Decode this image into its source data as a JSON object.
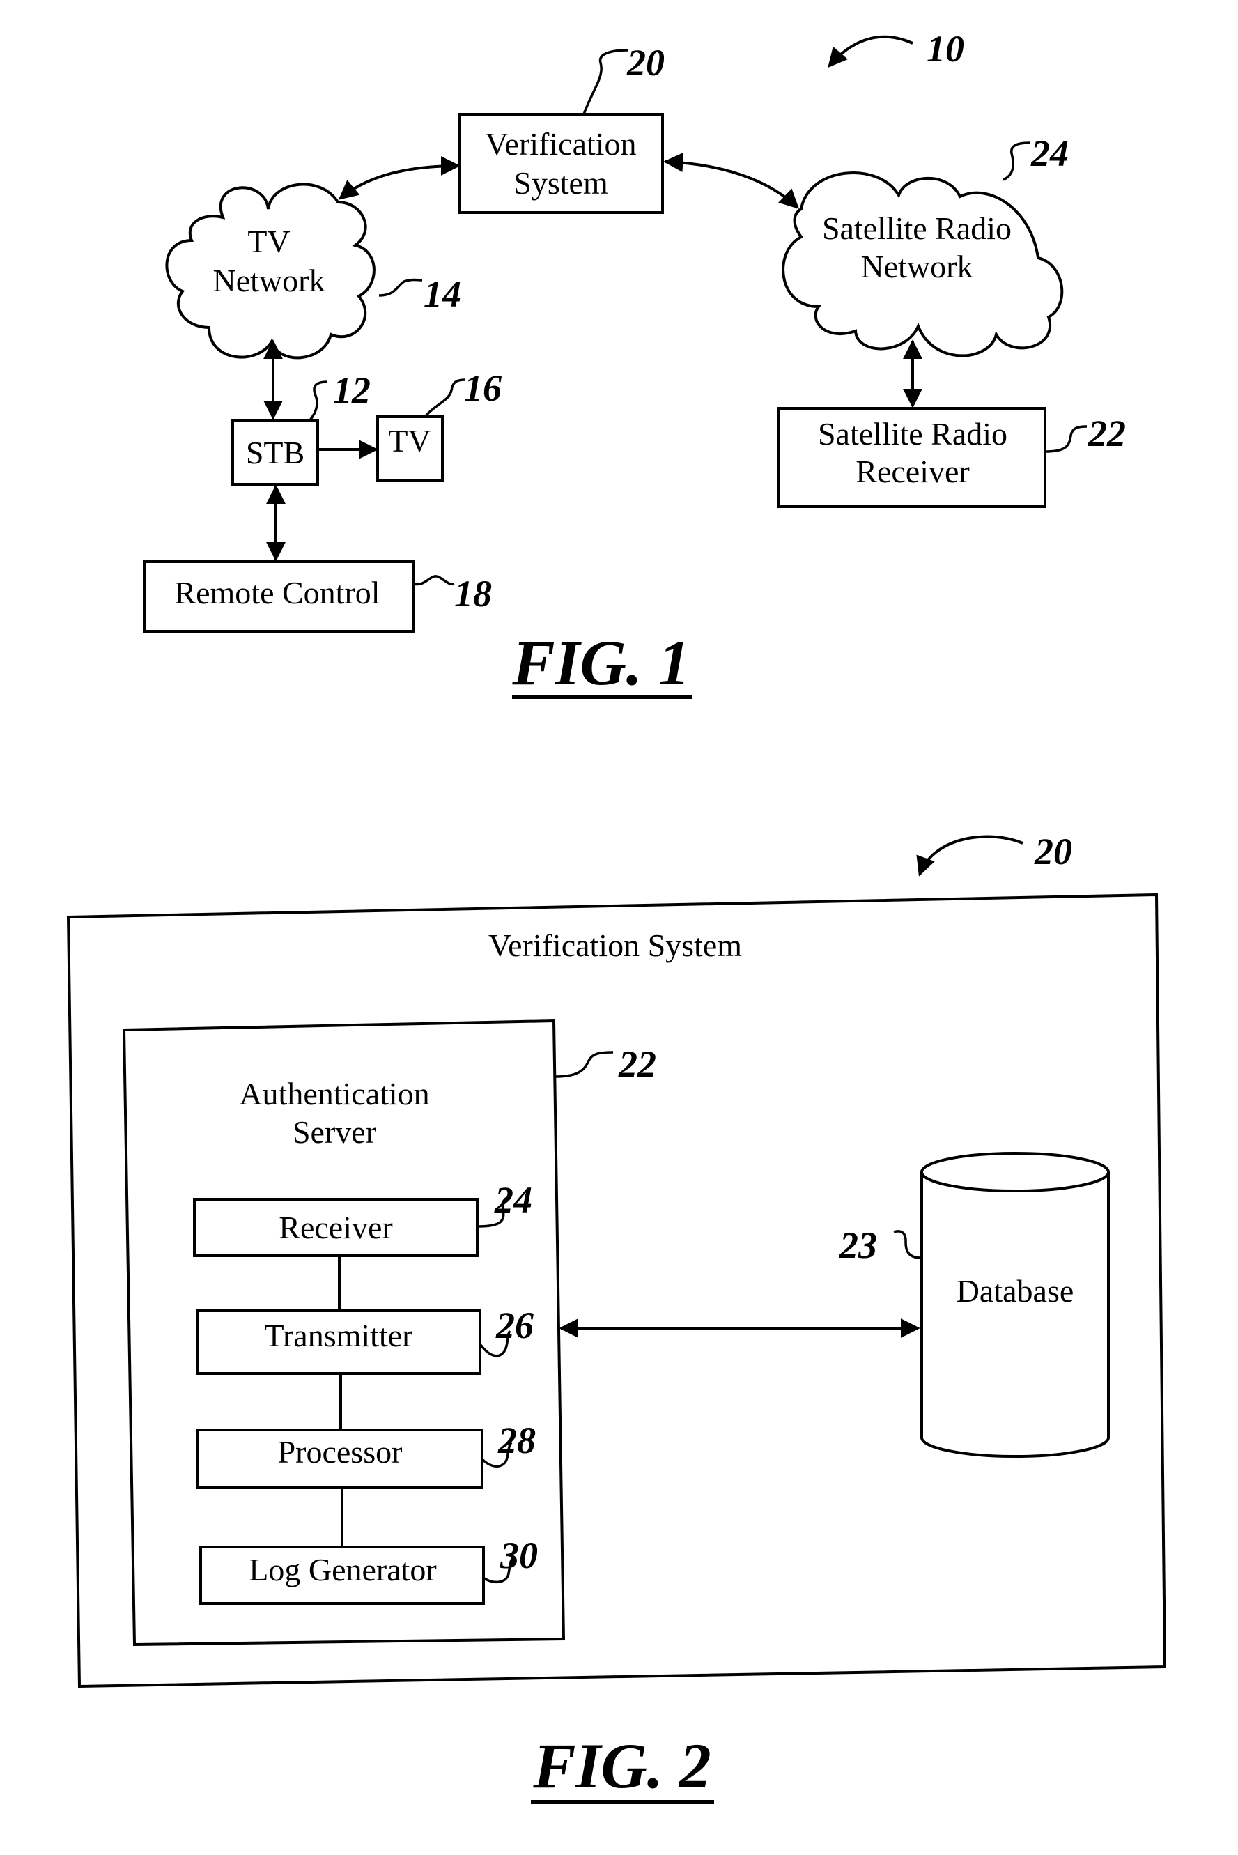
{
  "figure1": {
    "caption": "FIG. 1",
    "system_ref": "10",
    "nodes": {
      "verification_system": {
        "line1": "Verification",
        "line2": "System",
        "ref": "20"
      },
      "tv_network": {
        "line1": "TV",
        "line2": "Network",
        "ref": "14"
      },
      "satellite_radio_network": {
        "line1": "Satellite Radio",
        "line2": "Network",
        "ref": "24"
      },
      "stb": {
        "label": "STB",
        "ref": "12"
      },
      "tv": {
        "label": "TV",
        "ref": "16"
      },
      "remote_control": {
        "label": "Remote Control",
        "ref": "18"
      },
      "satellite_radio_receiver": {
        "line1": "Satellite Radio",
        "line2": "Receiver",
        "ref": "22"
      }
    }
  },
  "figure2": {
    "caption": "FIG. 2",
    "system_ref": "20",
    "container_label": "Verification System",
    "auth_server": {
      "line1": "Authentication",
      "line2": "Server",
      "ref": "22"
    },
    "components": [
      {
        "label": "Receiver",
        "ref": "24"
      },
      {
        "label": "Transmitter",
        "ref": "26"
      },
      {
        "label": "Processor",
        "ref": "28"
      },
      {
        "label": "Log Generator",
        "ref": "30"
      }
    ],
    "database": {
      "label": "Database",
      "ref": "23"
    }
  }
}
